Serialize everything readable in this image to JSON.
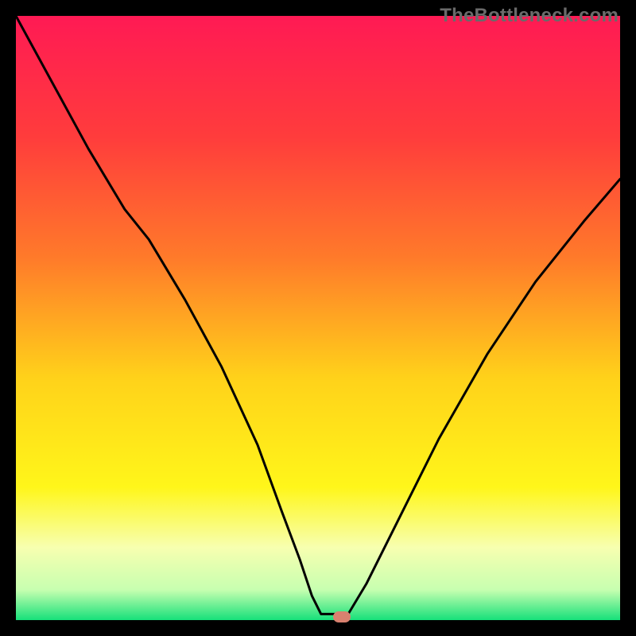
{
  "watermark": "TheBottleneck.com",
  "chart_data": {
    "type": "line",
    "title": "",
    "xlabel": "",
    "ylabel": "",
    "xlim": [
      0,
      100
    ],
    "ylim": [
      0,
      100
    ],
    "gradient_stops": [
      {
        "pos": 0.0,
        "color": "#ff1a54"
      },
      {
        "pos": 0.2,
        "color": "#ff3c3c"
      },
      {
        "pos": 0.4,
        "color": "#ff7a2a"
      },
      {
        "pos": 0.6,
        "color": "#ffd21a"
      },
      {
        "pos": 0.78,
        "color": "#fff61a"
      },
      {
        "pos": 0.88,
        "color": "#f7ffb0"
      },
      {
        "pos": 0.95,
        "color": "#c7ffb0"
      },
      {
        "pos": 1.0,
        "color": "#16e07a"
      }
    ],
    "series": [
      {
        "name": "bottleneck-curve",
        "x": [
          0,
          6,
          12,
          18,
          22,
          28,
          34,
          40,
          44,
          47,
          49,
          50.5,
          54,
          55,
          58,
          63,
          70,
          78,
          86,
          94,
          100
        ],
        "y": [
          100,
          89,
          78,
          68,
          63,
          53,
          42,
          29,
          18,
          10,
          4,
          1,
          1,
          1,
          6,
          16,
          30,
          44,
          56,
          66,
          73
        ]
      }
    ],
    "annotations": [
      {
        "name": "min-point-marker",
        "x": 54,
        "y": 0.5,
        "color": "#d9816f"
      }
    ]
  }
}
